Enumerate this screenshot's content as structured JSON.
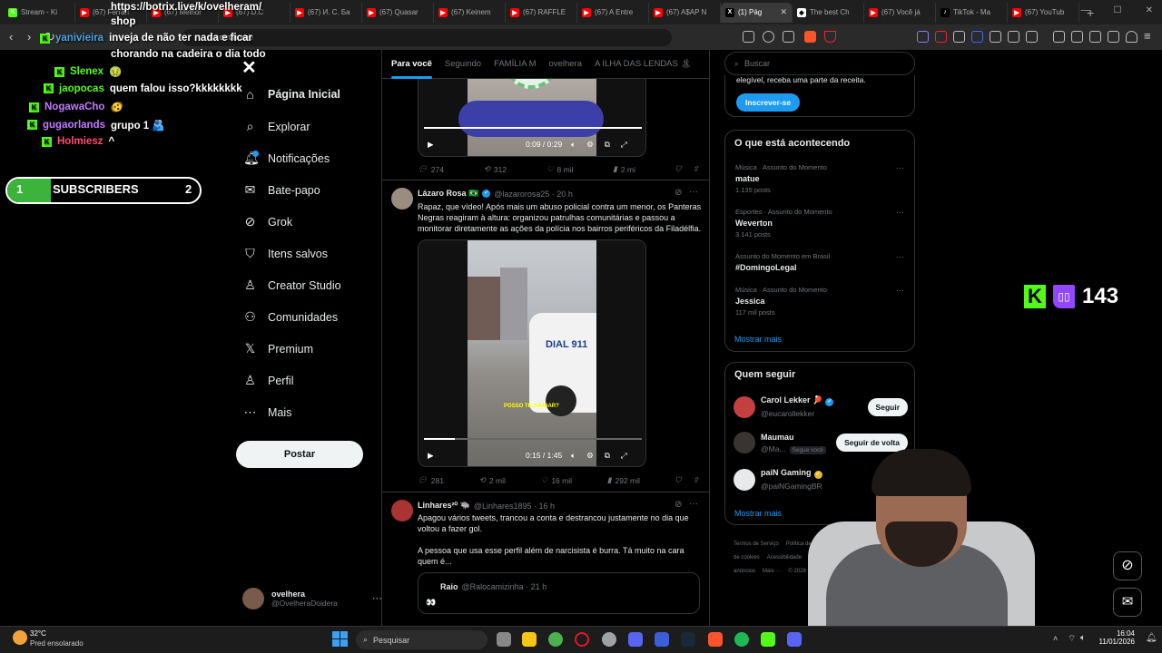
{
  "browser": {
    "tabs": [
      {
        "label": "Stream - Ki",
        "icon": "K",
        "color": "#53fc18",
        "active": false
      },
      {
        "label": "(67) Ferrari",
        "icon": "▶",
        "color": "#ff0000",
        "active": false
      },
      {
        "label": "(67) Melhor",
        "icon": "▶",
        "color": "#ff0000",
        "active": false
      },
      {
        "label": "(67) D.C",
        "icon": "▶",
        "color": "#ff0000",
        "active": false
      },
      {
        "label": "(67) И. С. Ба",
        "icon": "▶",
        "color": "#ff0000",
        "active": false
      },
      {
        "label": "(67) Quasar",
        "icon": "▶",
        "color": "#ff0000",
        "active": false
      },
      {
        "label": "(67) Keinem",
        "icon": "▶",
        "color": "#ff0000",
        "active": false
      },
      {
        "label": "(67) RAFFLE",
        "icon": "▶",
        "color": "#ff0000",
        "active": false
      },
      {
        "label": "(67) A Entre",
        "icon": "▶",
        "color": "#ff0000",
        "active": false
      },
      {
        "label": "(67) A$AP N",
        "icon": "▶",
        "color": "#ff0000",
        "active": false
      },
      {
        "label": "(1) Pág",
        "icon": "X",
        "color": "#000000",
        "active": true
      },
      {
        "label": "The best Ch",
        "icon": "◆",
        "color": "#ffffff",
        "active": false
      },
      {
        "label": "(67) Você já",
        "icon": "▶",
        "color": "#ff0000",
        "active": false
      },
      {
        "label": "TikTok - Ma",
        "icon": "♪",
        "color": "#000000",
        "active": false
      },
      {
        "label": "(67) YouTub",
        "icon": "▶",
        "color": "#ff0000",
        "active": false
      }
    ],
    "url": "x.com/home"
  },
  "overlay": {
    "link_line1": "https://botrix.live/k/ovelheram/",
    "link_line2": "shop",
    "chat": [
      {
        "user": "yanivieira",
        "color": "#4aa3df",
        "msg": "inveja de não ter nada e ficar"
      },
      {
        "user": "",
        "color": "#ffffff",
        "msg": "chorando na cadeira o dia todo"
      },
      {
        "user": "Slenex",
        "color": "#53fc18",
        "msg": "🤢"
      },
      {
        "user": "jaopocas",
        "color": "#53fc18",
        "msg": "quem falou isso?kkkkkkkk"
      },
      {
        "user": "NogawaCho",
        "color": "#c27bff",
        "msg": "🫨"
      },
      {
        "user": "gugaorlands",
        "color": "#c27bff",
        "msg": "grupo 1 🫂"
      },
      {
        "user": "Holmiesz",
        "color": "#ff4d6d",
        "msg": "^"
      }
    ],
    "subs": {
      "left": "1",
      "label": "SUBSCRIBERS",
      "right": "2",
      "progress": 0.5
    },
    "viewers": "143"
  },
  "nav": {
    "items": [
      {
        "label": "Página Inicial",
        "icon": "home-icon",
        "glyph": "⌂"
      },
      {
        "label": "Explorar",
        "icon": "search-icon",
        "glyph": "⌕"
      },
      {
        "label": "Notificações",
        "icon": "bell-icon",
        "glyph": "🔔︎"
      },
      {
        "label": "Bate-papo",
        "icon": "mail-icon",
        "glyph": "✉"
      },
      {
        "label": "Grok",
        "icon": "grok-icon",
        "glyph": "⊘"
      },
      {
        "label": "Itens salvos",
        "icon": "bookmark-icon",
        "glyph": "⛉"
      },
      {
        "label": "Creator Studio",
        "icon": "creator-icon",
        "glyph": "♙"
      },
      {
        "label": "Comunidades",
        "icon": "communities-icon",
        "glyph": "⚇"
      },
      {
        "label": "Premium",
        "icon": "x-premium-icon",
        "glyph": "𝕏"
      },
      {
        "label": "Perfil",
        "icon": "profile-icon",
        "glyph": "♙"
      },
      {
        "label": "Mais",
        "icon": "more-icon",
        "glyph": "⋯"
      }
    ],
    "post_label": "Postar",
    "me_name": "ovelhera",
    "me_handle": "@OvelheraDoidera"
  },
  "timeline": {
    "tabs": [
      "Para você",
      "Seguindo",
      "FAMÍLIA M",
      "ovelhera",
      "A ILHA DAS LENDAS 🏝"
    ],
    "tweet1": {
      "time": "0:09 / 0:29",
      "replies": "274",
      "reposts": "312",
      "likes": "8 mil",
      "views": "2 mi",
      "progress": 1.0
    },
    "tweet2": {
      "name": "Lázaro Rosa 🇧🇷",
      "handle": "@lazarorosa25 · 20 h",
      "text": "Rapaz, que vídeo! Após mais um abuso policial contra um menor, os Panteras Negras reagiram à altura: organizou patrulhas comunitárias e passou a monitorar diretamente as ações da polícia nos bairros periféricos da Filadélfia.",
      "caption": "POSSO TE AJUDAR?",
      "car_label": "DIAL 911",
      "time": "0:15 / 1:45",
      "progress": 0.14,
      "replies": "281",
      "reposts": "2 mil",
      "likes": "16 mil",
      "views": "292 mil"
    },
    "tweet3": {
      "name": "Linhares²⁰ 🐃",
      "handle": "@Linhares1895 · 16 h",
      "text1": "Apagou vários tweets, trancou a conta e destrancou justamente no dia que voltou a fazer gol.",
      "text2": "A pessoa que usa esse perfil além de narcisista é burra. Tá muito na cara quem é...",
      "quote_name": "Raio",
      "quote_handle": "@Ralocamizinha · 21 h",
      "quote_text": "👀"
    }
  },
  "sidebar": {
    "search_placeholder": "Buscar",
    "premium_text": "elegível, receba uma parte da receita.",
    "subscribe_label": "Inscrever-se",
    "trends_title": "O que está acontecendo",
    "trends": [
      {
        "category": "Música · Assunto do Momento",
        "title": "matue",
        "count": "1.135 posts"
      },
      {
        "category": "Esportes · Assunto do Momento",
        "title": "Weverton",
        "count": "3.141 posts"
      },
      {
        "category": "Assunto do Momento em Brasil",
        "title": "#DomingoLegal",
        "count": ""
      },
      {
        "category": "Música · Assunto do Momento",
        "title": "Jessica",
        "count": "117 mil posts"
      }
    ],
    "show_more": "Mostrar mais",
    "who_title": "Quem seguir",
    "who": [
      {
        "name": "Carol Lekker 🏓",
        "handle": "@eucarollekker",
        "btn": "Seguir",
        "badge": ""
      },
      {
        "name": "Maumau",
        "handle": "@Ma...",
        "btn": "Seguir de volta",
        "badge": "Segue você"
      },
      {
        "name": "paiN Gaming",
        "handle": "@paiNGamingBR",
        "btn": "",
        "badge": ""
      }
    ],
    "footer": [
      "Termos de Serviço",
      "Política de Privacidade",
      "Política de cookies",
      "Acessibilidade",
      "Informações de anúncios",
      "Mais ···",
      "© 2026"
    ]
  },
  "taskbar": {
    "weather_temp": "32°C",
    "weather_desc": "Pred ensolarado",
    "search": "Pesquisar",
    "time": "16:04",
    "date": "11/01/2026"
  }
}
